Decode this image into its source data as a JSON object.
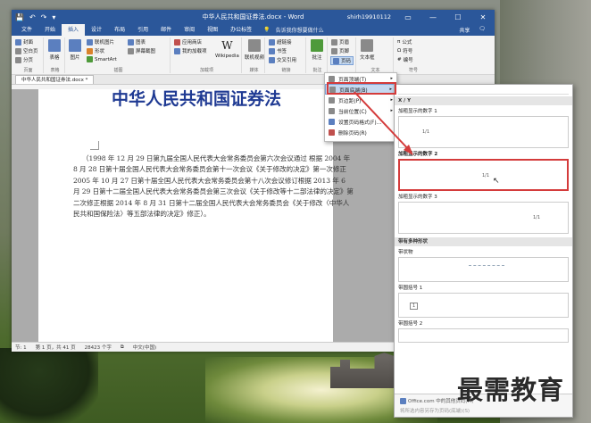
{
  "window": {
    "title": "中华人民共和国证券法.docx - Word",
    "user": "shirh19910112",
    "qat": {
      "save": "💾",
      "undo": "↶",
      "redo": "↷",
      "custom": "▾"
    }
  },
  "tabs": [
    "文件",
    "开始",
    "插入",
    "设计",
    "布局",
    "引用",
    "邮件",
    "审阅",
    "视图",
    "办公标签"
  ],
  "active_tab": "插入",
  "tell_me": "告诉我你想要做什么",
  "share": "共享",
  "ribbon": {
    "pages": {
      "label": "页面",
      "cover": "封面",
      "blank": "空白页",
      "break": "分页"
    },
    "table": {
      "label": "表格",
      "btn": "表格"
    },
    "illustrations": {
      "label": "插图",
      "picture": "图片",
      "online_pic": "联机图片",
      "shapes": "形状",
      "smartart": "SmartArt",
      "chart": "图表",
      "screenshot": "屏幕截图"
    },
    "addins": {
      "label": "加载项",
      "store": "应用商店",
      "my": "我的加载项",
      "wiki": "Wikipedia"
    },
    "media": {
      "label": "媒体",
      "online_video": "联机视频"
    },
    "links": {
      "label": "链接",
      "hyperlink": "超链接",
      "bookmark": "书签",
      "crossref": "交叉引用"
    },
    "comments": {
      "label": "批注",
      "btn": "批注"
    },
    "header_footer": {
      "header": "页眉",
      "footer": "页脚",
      "page_num": "页码"
    },
    "text": {
      "label": "文本",
      "textbox": "文本框"
    },
    "symbols": {
      "label": "符号",
      "equation": "公式",
      "symbol": "符号",
      "number": "编号"
    }
  },
  "doc_tab": "中华人民共和国证券法.docx *",
  "document": {
    "title": "中华人民共和国证券法",
    "paragraph": "（1998 年 12 月 29 日第九届全国人民代表大会常务委员会第六次会议通过 根据 2004 年 8 月 28 日第十届全国人民代表大会常务委员会第十一次会议《关于修改的决定》第一次修正 2005 年 10 月 27 日第十届全国人民代表大会常务委员会第十八次会议修订根据 2013 年 6 月 29 日第十二届全国人民代表大会常务委员会第三次会议《关于修改等十二部法律的决定》第二次修正根据 2014 年 8 月 31 日第十二届全国人民代表大会常务委员会《关于修改〈中华人民共和国保险法〉等五部法律的决定》修正）。"
  },
  "statusbar": {
    "section": "节: 1",
    "page": "第 1 页，共 41 页",
    "words": "28423 个字",
    "lang": "中文(中国)"
  },
  "page_menu": {
    "items": [
      {
        "label": "页面顶端(T)",
        "arrow": "▸"
      },
      {
        "label": "页面底端(B)",
        "arrow": "▸"
      },
      {
        "label": "页边距(P)",
        "arrow": "▸"
      },
      {
        "label": "当前位置(C)",
        "arrow": "▸"
      },
      {
        "label": "设置页码格式(F)...",
        "arrow": ""
      },
      {
        "label": "删除页码(R)",
        "arrow": ""
      }
    ],
    "highlighted": 1
  },
  "gallery": {
    "section1": "X / Y",
    "items1": [
      {
        "label": "加粗显示的数字 1",
        "num": "1/1"
      },
      {
        "label": "加粗显示的数字 2",
        "num": "1/1"
      },
      {
        "label": "加粗显示的数字 3",
        "num": "1/1"
      }
    ],
    "section2": "带有多种形状",
    "items2": [
      {
        "label": "带状物",
        "num": ""
      },
      {
        "label": "带圆括号 1",
        "num": "1"
      },
      {
        "label": "带圆括号 2",
        "num": ""
      }
    ],
    "footer1": "Office.com 中的其他页码(M)",
    "footer2": "将所选内容另存为页码(底端)(S)"
  },
  "watermark": "最需教育"
}
